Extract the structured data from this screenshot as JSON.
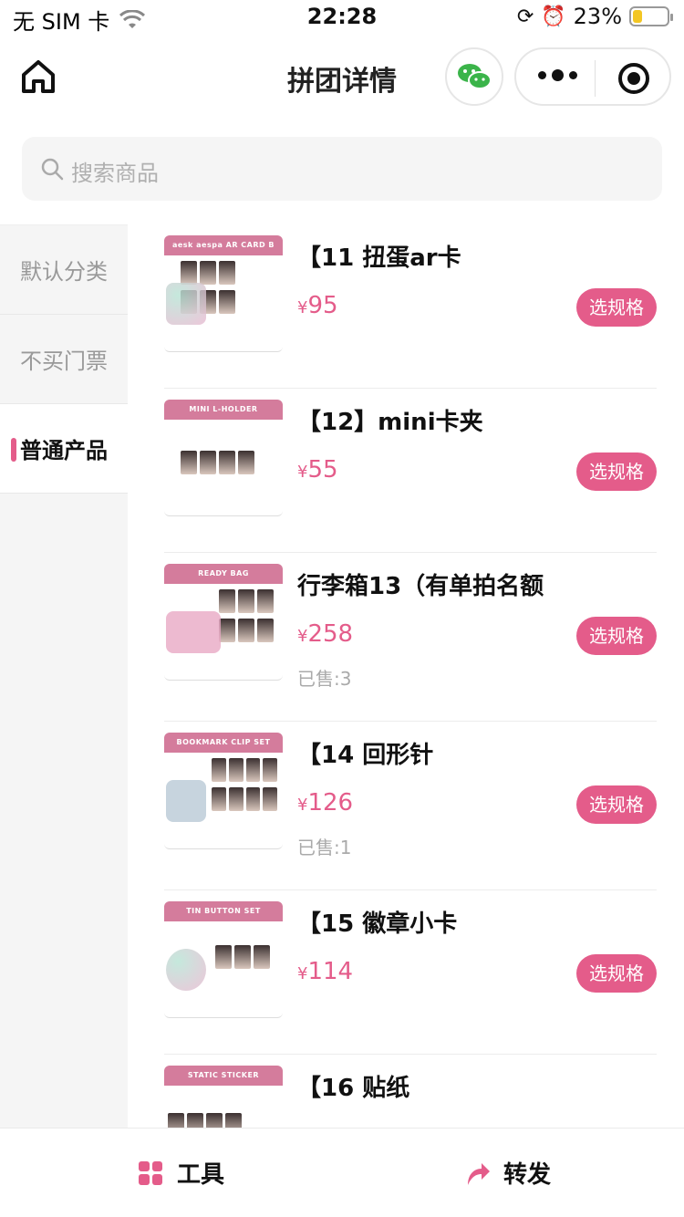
{
  "status": {
    "carrier": "无 SIM 卡",
    "time": "22:28",
    "battery": "23%"
  },
  "nav": {
    "title": "拼团详情"
  },
  "search": {
    "placeholder": "搜索商品"
  },
  "sidebar": {
    "items": [
      {
        "label": "默认分类"
      },
      {
        "label": "不买门票"
      },
      {
        "label": "普通产品"
      }
    ]
  },
  "products": [
    {
      "name": "【11 扭蛋ar卡",
      "price": "95",
      "sold": "",
      "button": "选规格",
      "banner": "aesk aespa AR CARD B"
    },
    {
      "name": "【12】mini卡夹",
      "price": "55",
      "sold": "",
      "button": "选规格",
      "banner": "MINI L-HOLDER"
    },
    {
      "name": "行李箱13（有单拍名额",
      "price": "258",
      "sold": "已售:3",
      "button": "选规格",
      "banner": "READY BAG"
    },
    {
      "name": "【14 回形针",
      "price": "126",
      "sold": "已售:1",
      "button": "选规格",
      "banner": "BOOKMARK CLIP SET"
    },
    {
      "name": "【15 徽章小卡",
      "price": "114",
      "sold": "",
      "button": "选规格",
      "banner": "TIN BUTTON SET"
    },
    {
      "name": "【16 贴纸",
      "price": "",
      "sold": "",
      "button": "",
      "banner": "STATIC STICKER"
    }
  ],
  "currency": "¥",
  "bottom": {
    "tool_label": "工具",
    "share_label": "转发"
  },
  "colors": {
    "accent": "#e45c8a"
  }
}
